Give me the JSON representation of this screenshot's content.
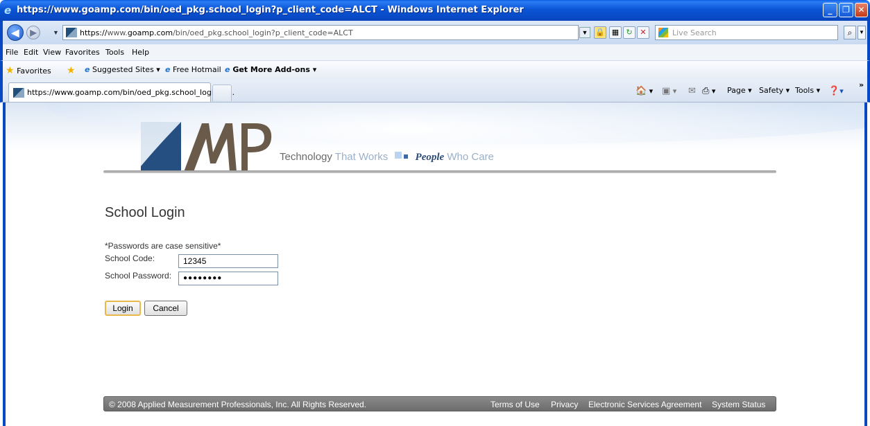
{
  "window": {
    "title": "https://www.goamp.com/bin/oed_pkg.school_login?p_client_code=ALCT - Windows Internet Explorer"
  },
  "address_bar": {
    "url_prefix": "https://",
    "url_domain_light": "www.",
    "url_domain": "goamp.com",
    "url_path": "/bin/oed_pkg.school_login?p_client_code=ALCT"
  },
  "search": {
    "placeholder": "Live Search"
  },
  "menu": [
    "File",
    "Edit",
    "View",
    "Favorites",
    "Tools",
    "Help"
  ],
  "favorites_bar": {
    "favorites_label": "Favorites",
    "suggested_sites": "Suggested Sites",
    "free_hotmail": "Free Hotmail",
    "get_addons": "Get More Add-ons"
  },
  "tab": {
    "label": "https://www.goamp.com/bin/oed_pkg.school_login?p..."
  },
  "command_bar": {
    "page": "Page",
    "safety": "Safety",
    "tools": "Tools"
  },
  "header": {
    "tagline_1": "Technology",
    "tagline_2": "That Works",
    "tagline_3": "People",
    "tagline_4": "Who Care"
  },
  "login": {
    "title": "School Login",
    "note": "*Passwords are case sensitive*",
    "school_code_label": "School Code:",
    "school_code_value": "12345",
    "school_password_label": "School Password:",
    "school_password_mask": "●●●●●●●●",
    "login_button": "Login",
    "cancel_button": "Cancel"
  },
  "footer": {
    "copyright": "© 2008 Applied Measurement Professionals, Inc. All Rights Reserved.",
    "links": [
      "Terms of Use",
      "Privacy",
      "Electronic Services Agreement",
      "System Status"
    ]
  },
  "colors": {
    "titlebar": "#0a55d6",
    "footer_bg": "#7a7a7a",
    "login_focus": "#e8b84a",
    "brand_navy": "#2d4d78"
  }
}
